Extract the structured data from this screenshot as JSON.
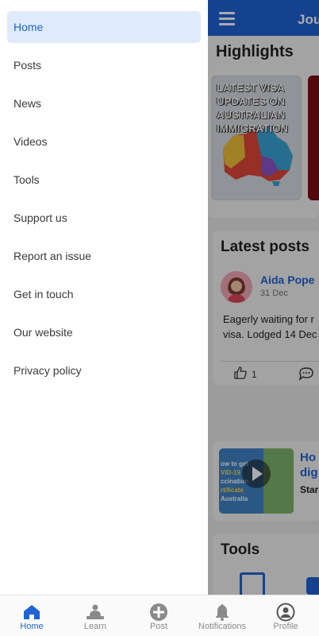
{
  "app": {
    "title": "Jou"
  },
  "drawer": {
    "items": [
      {
        "label": "Home",
        "active": true
      },
      {
        "label": "Posts"
      },
      {
        "label": "News"
      },
      {
        "label": "Videos"
      },
      {
        "label": "Tools"
      },
      {
        "label": "Support us"
      },
      {
        "label": "Report an issue"
      },
      {
        "label": "Get in touch"
      },
      {
        "label": "Our website"
      },
      {
        "label": "Privacy policy"
      }
    ]
  },
  "highlights": {
    "title": "Highlights",
    "card_caption": "LATEST VISA UPDATES ON AUSTRALIAN IMMIGRATION"
  },
  "latest_posts": {
    "title": "Latest posts",
    "author": "Aida Pope",
    "date": "31 Dec",
    "text": "Eagerly waiting for r visa. Lodged 14 Dec",
    "likes": "1"
  },
  "video": {
    "title_line1": "Ho",
    "title_line2": "dig",
    "subtitle": "Star",
    "thumb_line1": "ow to get",
    "thumb_line2": "VID-19",
    "thumb_line3": "ccination",
    "thumb_line4": "rtificate",
    "thumb_line5": "Australia"
  },
  "tools": {
    "title": "Tools"
  },
  "tabbar": {
    "tabs": [
      {
        "label": "Home",
        "icon": "home-icon",
        "active": true
      },
      {
        "label": "Learn",
        "icon": "learn-icon"
      },
      {
        "label": "Post",
        "icon": "post-plus-icon"
      },
      {
        "label": "Notifications",
        "icon": "bell-icon"
      },
      {
        "label": "Profile",
        "icon": "profile-icon"
      }
    ]
  },
  "colors": {
    "accent": "#1f63d6",
    "active_bg": "#dfeafb"
  }
}
